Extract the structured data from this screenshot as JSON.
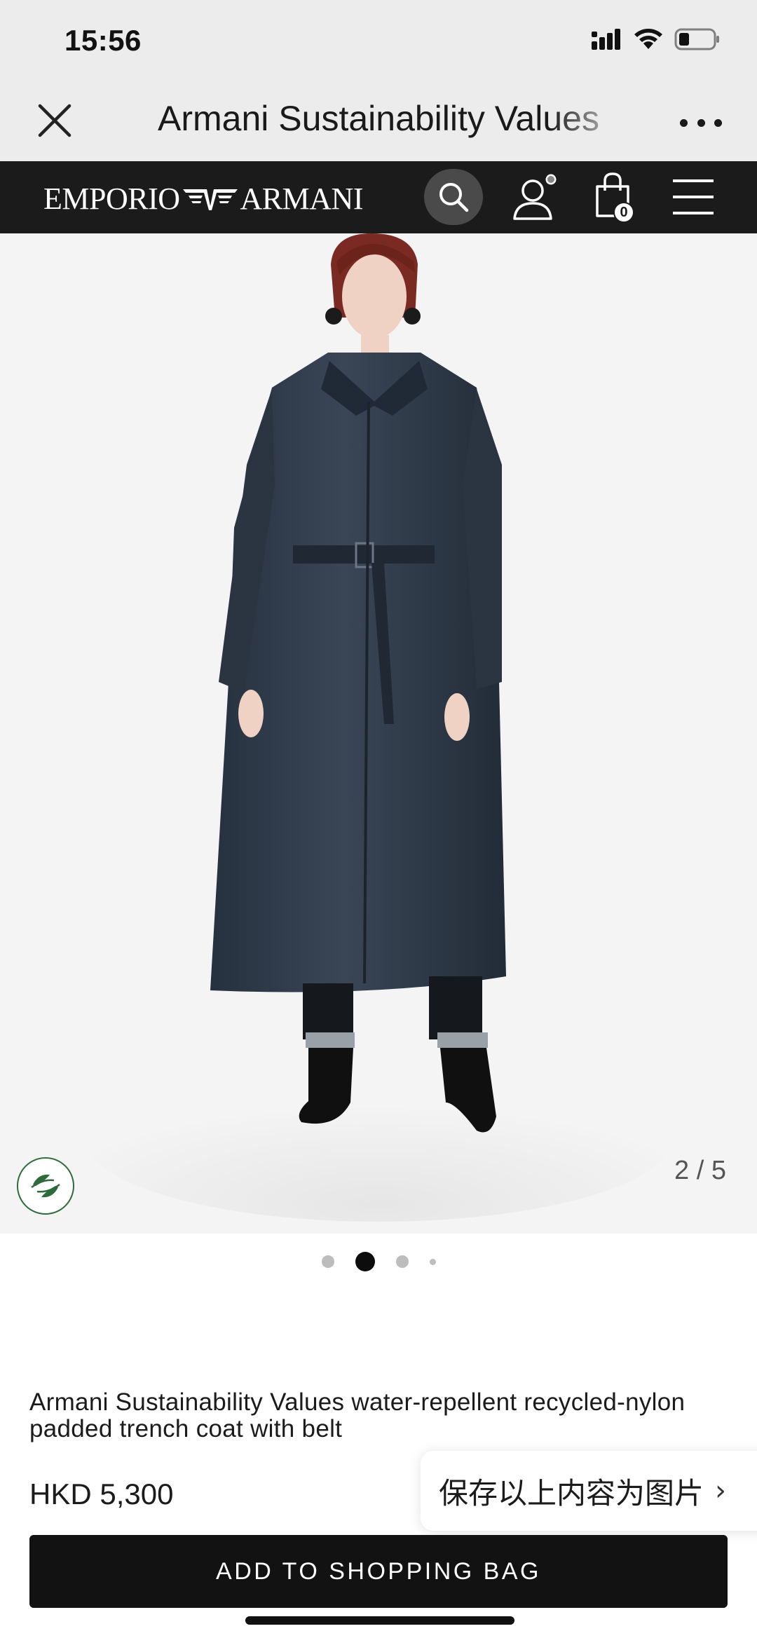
{
  "status_bar": {
    "time": "15:56"
  },
  "webview": {
    "title": "Armani Sustainability Values",
    "close_icon": "close-icon",
    "more_icon": "more-horizontal-icon"
  },
  "site_nav": {
    "brand": "EMPORIO ARMANI",
    "brand_left": "EMPORIO",
    "brand_right": "ARMANI",
    "bag_count": "0",
    "icons": [
      "search-icon",
      "account-icon",
      "shopping-bag-icon",
      "hamburger-menu-icon"
    ]
  },
  "gallery": {
    "counter": "2 / 5",
    "current_index": 2,
    "total": 5,
    "badge_icon": "sustainability-leaf-icon"
  },
  "product": {
    "name": "Armani Sustainability Values water-repellent recycled-nylon padded trench coat with belt",
    "price": "HKD 5,300"
  },
  "overlay": {
    "save_as_image": "保存以上内容为图片",
    "chevron": "›"
  },
  "actions": {
    "add_to_bag": "ADD TO SHOPPING BAG"
  },
  "colors": {
    "nav_bg": "#1b1b1b",
    "button_bg": "#121212",
    "badge_green": "#2e6b3a"
  }
}
